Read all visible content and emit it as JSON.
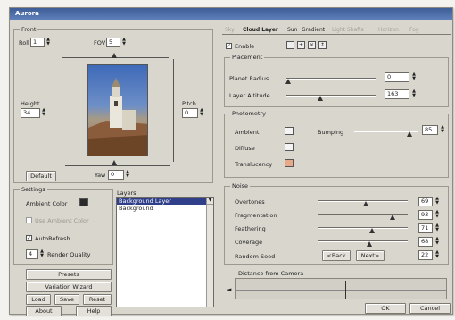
{
  "window": {
    "title": "Aurora"
  },
  "front": {
    "title": "Front",
    "roll_label": "Roll",
    "roll_value": "1",
    "fov_label": "FOV",
    "fov_value": "5",
    "height_label": "Height",
    "height_value": "34",
    "pitch_label": "Pitch",
    "pitch_value": "0",
    "yaw_label": "Yaw",
    "yaw_value": "0",
    "default_button": "Default"
  },
  "settings": {
    "title": "Settings",
    "ambient_color_label": "Ambient Color",
    "disabled_option": "Use Ambient Color",
    "autorefresh_label": "AutoRefresh",
    "autorefresh_checked": true,
    "render_quality_label": "Render Quality",
    "render_quality_value": "4"
  },
  "layers": {
    "title": "Layers",
    "items": [
      "Background Layer",
      "Background"
    ],
    "selected_index": 0
  },
  "bottom_buttons": {
    "presets": "Presets",
    "variation_wizard": "Variation Wizard",
    "load": "Load",
    "save": "Save",
    "reset": "Reset",
    "about": "About",
    "help": "Help"
  },
  "tabs": [
    "Sky",
    "Cloud Layer",
    "Sun",
    "Gradient",
    "Light Shafts",
    "Horizon",
    "Fog"
  ],
  "active_tab": "Cloud Layer",
  "enable": {
    "label": "Enable",
    "checked": true
  },
  "placement": {
    "title": "Placement",
    "planet_radius_label": "Planet Radius",
    "planet_radius_value": "0",
    "layer_altitude_label": "Layer Altitude",
    "layer_altitude_value": "163"
  },
  "photometry": {
    "title": "Photometry",
    "ambient_label": "Ambient",
    "diffuse_label": "Diffuse",
    "translucency_label": "Translucency",
    "bumping_label": "Bumping",
    "bumping_value": "85",
    "ambient_color": "#f4f4f4",
    "diffuse_color": "#f4f4f4",
    "translucency_color": "#e8a88a"
  },
  "noise": {
    "title": "Noise",
    "overtones_label": "Overtones",
    "overtones_value": "69",
    "fragmentation_label": "Fragmentation",
    "fragmentation_value": "93",
    "feathering_label": "Feathering",
    "feathering_value": "71",
    "coverage_label": "Coverage",
    "coverage_value": "68",
    "random_seed_label": "Random Seed",
    "random_seed_value": "22",
    "back_button": "<Back",
    "next_button": "Next>"
  },
  "distance": {
    "title": "Distance from Camera"
  },
  "dialog": {
    "ok": "OK",
    "cancel": "Cancel"
  }
}
